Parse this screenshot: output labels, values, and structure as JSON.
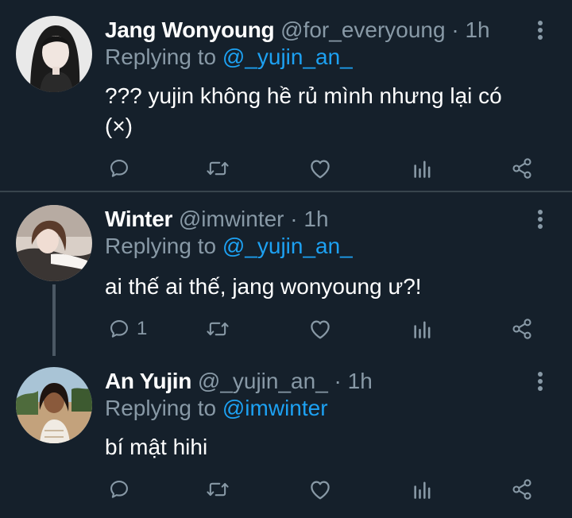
{
  "tweets": [
    {
      "name": "Jang Wonyoung",
      "meta": "@for_everyoung · 1h",
      "replying_prefix": "Replying to ",
      "replying_handle": "@_yujin_an_",
      "text_line1": "??? yujin không hề rủ mình nhưng lại có",
      "text_line2": "(×)",
      "reply_count": ""
    },
    {
      "name": "Winter",
      "meta": "@imwinter · 1h",
      "replying_prefix": "Replying to ",
      "replying_handle": "@_yujin_an_",
      "text_line1": "ai thế ai thế, jang wonyoung ư?!",
      "reply_count": "1"
    },
    {
      "name": "An Yujin",
      "meta": "@_yujin_an_ · 1h",
      "replying_prefix": "Replying to ",
      "replying_handle": "@imwinter",
      "text_line1": "bí mật hihi",
      "reply_count": ""
    }
  ],
  "icons": [
    "reply-icon",
    "retweet-icon",
    "like-icon",
    "analytics-icon",
    "share-icon",
    "more-options-icon"
  ],
  "colors": {
    "background": "#15202b",
    "text": "#ffffff",
    "secondary": "#8899a6",
    "link": "#1da1f2",
    "divider": "#38444d"
  }
}
